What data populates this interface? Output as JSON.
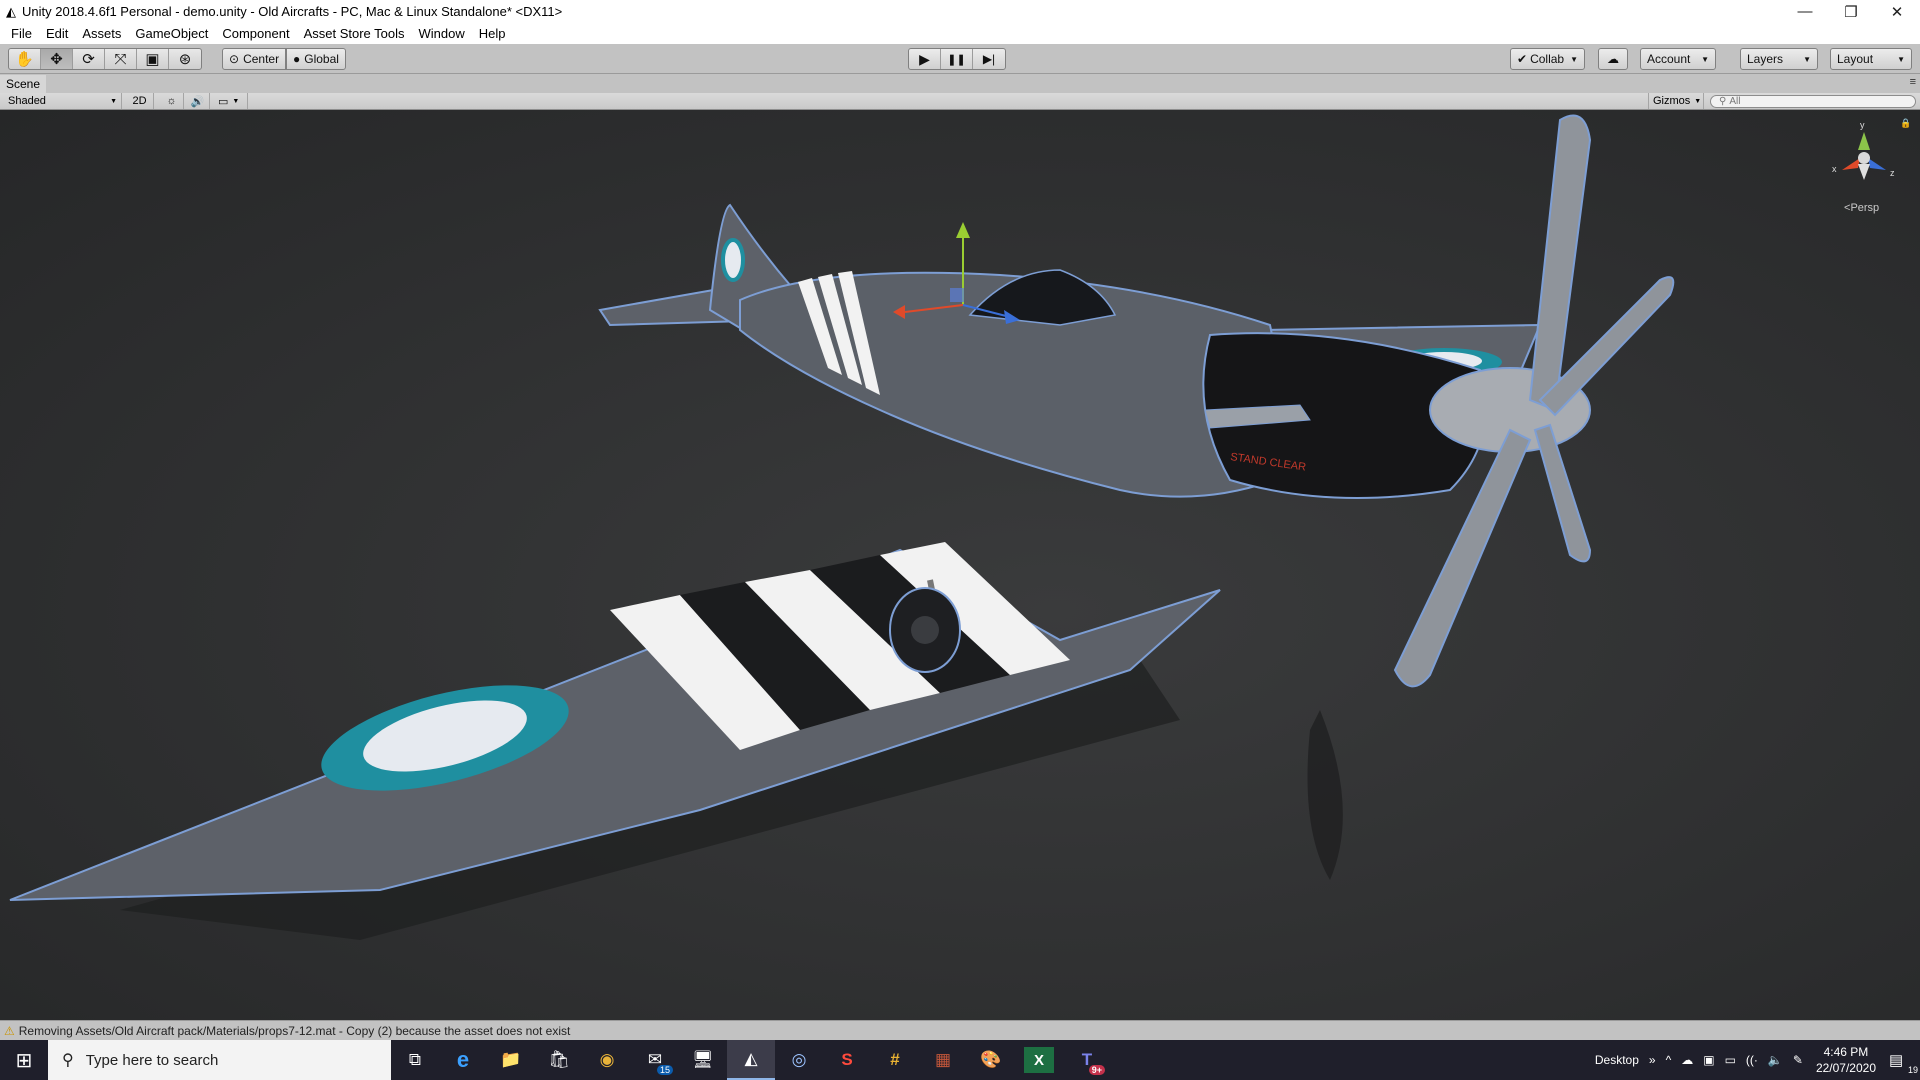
{
  "window": {
    "title": "Unity 2018.4.6f1 Personal - demo.unity - Old Aircrafts - PC, Mac & Linux Standalone* <DX11>",
    "app_icon": "unity-logo-icon",
    "controls": {
      "minimize": "—",
      "restore": "❐",
      "close": "✕"
    }
  },
  "menubar": {
    "items": [
      "File",
      "Edit",
      "Assets",
      "GameObject",
      "Component",
      "Asset Store Tools",
      "Window",
      "Help"
    ]
  },
  "toolbar": {
    "tools": [
      {
        "name": "hand-tool",
        "icon": "✋"
      },
      {
        "name": "move-tool",
        "icon": "✥"
      },
      {
        "name": "rotate-tool",
        "icon": "⟳"
      },
      {
        "name": "scale-tool",
        "icon": "⤧"
      },
      {
        "name": "rect-tool",
        "icon": "▣"
      },
      {
        "name": "transform-tool",
        "icon": "⊛"
      }
    ],
    "active_tool": "move-tool",
    "pivot_label": "Center",
    "space_label": "Global",
    "play_controls": {
      "play": "▶",
      "pause": "❚❚",
      "step": "▶|"
    },
    "collab_label": "Collab",
    "account_label": "Account",
    "layers_label": "Layers",
    "layout_label": "Layout"
  },
  "scene": {
    "tab_label": "Scene",
    "shading_mode": "Shaded",
    "mode_2d": "2D",
    "gizmos_label": "Gizmos",
    "search_placeholder": "All",
    "projection_label": "Persp",
    "gizmo_axes": {
      "x": "x",
      "y": "y",
      "z": "z"
    },
    "plane_decal_text": "STAND CLEAR",
    "colors": {
      "background": "#2e2f30",
      "fuselage": "#5b6068",
      "roundel_outer": "#1f8fa0",
      "roundel_inner": "#e6eaf0",
      "cowling": "#151517",
      "outline": "#7d9ed4"
    }
  },
  "statusbar": {
    "message": "Removing Assets/Old Aircraft pack/Materials/props7-12.mat - Copy (2) because the asset does not exist"
  },
  "taskbar": {
    "search_placeholder": "Type here to search",
    "apps": [
      {
        "name": "task-view-icon",
        "glyph": "⧉",
        "badge": ""
      },
      {
        "name": "edge-icon",
        "glyph": "e",
        "badge": ""
      },
      {
        "name": "file-explorer-icon",
        "glyph": "📁",
        "badge": ""
      },
      {
        "name": "store-icon",
        "glyph": "🛍",
        "badge": ""
      },
      {
        "name": "chrome-icon",
        "glyph": "◉",
        "badge": ""
      },
      {
        "name": "mail-icon",
        "glyph": "✉",
        "badge": "15"
      },
      {
        "name": "remote-desktop-icon",
        "glyph": "🖥",
        "badge": ""
      },
      {
        "name": "unity-icon",
        "glyph": "◭",
        "badge": ""
      },
      {
        "name": "cinema4d-icon",
        "glyph": "◎",
        "badge": ""
      },
      {
        "name": "substance-icon",
        "glyph": "S",
        "badge": ""
      },
      {
        "name": "slack-icon",
        "glyph": "#",
        "badge": ""
      },
      {
        "name": "winrar-icon",
        "glyph": "▦",
        "badge": ""
      },
      {
        "name": "paint-icon",
        "glyph": "🎨",
        "badge": ""
      },
      {
        "name": "excel-icon",
        "glyph": "X",
        "badge": ""
      },
      {
        "name": "teams-icon",
        "glyph": "T",
        "badge": "9+"
      }
    ],
    "tray_desktop_label": "Desktop",
    "tray_overflow": "»",
    "time": "4:46 PM",
    "date": "22/07/2020",
    "notification_count": "19"
  }
}
